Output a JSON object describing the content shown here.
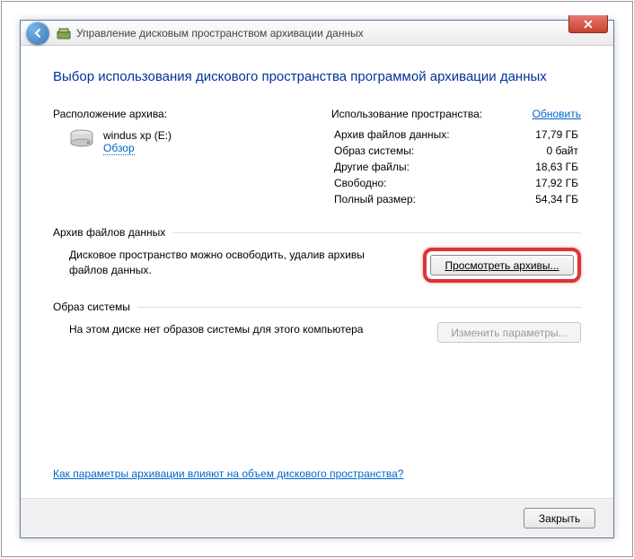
{
  "titlebar": {
    "title": "Управление дисковым пространством архивации данных"
  },
  "heading": "Выбор использования дискового пространства программой архивации данных",
  "location": {
    "label": "Расположение архива:",
    "drive_name": "windus xp (E:)",
    "browse": "Обзор"
  },
  "usage": {
    "label": "Использование пространства:",
    "refresh": "Обновить",
    "rows": [
      {
        "k": "Архив файлов данных:",
        "v": "17,79 ГБ"
      },
      {
        "k": "Образ системы:",
        "v": "0 байт"
      },
      {
        "k": "Другие файлы:",
        "v": "18,63 ГБ"
      },
      {
        "k": "Свободно:",
        "v": "17,92 ГБ"
      },
      {
        "k": "Полный размер:",
        "v": "54,34 ГБ"
      }
    ]
  },
  "section_data": {
    "title": "Архив файлов данных",
    "text": "Дисковое пространство можно освободить, удалив архивы файлов данных.",
    "button": "Просмотреть архивы..."
  },
  "section_image": {
    "title": "Образ системы",
    "text": "На этом диске нет образов системы для этого компьютера",
    "button": "Изменить параметры..."
  },
  "seealso": "Как параметры архивации влияют на объем дискового пространства?",
  "footer": {
    "close": "Закрыть"
  }
}
